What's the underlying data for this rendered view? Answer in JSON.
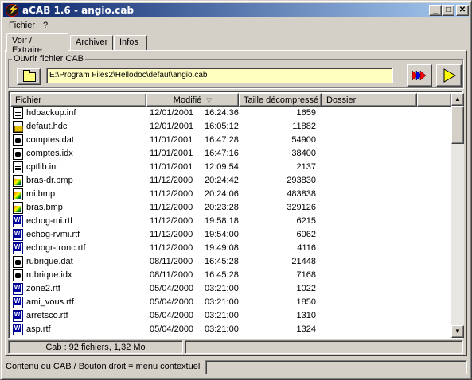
{
  "window": {
    "title": "aCAB 1.6 - angio.cab",
    "min_label": "_",
    "max_label": "□",
    "close_label": "✕"
  },
  "menu": {
    "fichier": "Fichier",
    "help": "?"
  },
  "tabs": [
    {
      "label": "Voir / Extraire",
      "active": true
    },
    {
      "label": "Archiver",
      "active": false
    },
    {
      "label": "Infos",
      "active": false
    }
  ],
  "open_group": {
    "legend": "Ouvrir fichier CAB",
    "path": "E:\\Program Files2\\Hellodoc\\defaut\\angio.cab"
  },
  "icons": {
    "open_button": "folder-open-icon",
    "extract_all_button": "extract-all-arrows-icon",
    "play_button": "play-icon"
  },
  "colors": {
    "title_gradient_start": "#0a246a",
    "title_gradient_end": "#a6caf0",
    "path_background": "#ffffc0",
    "arrow_red": "#ff0000",
    "arrow_blue": "#0000ff",
    "play_yellow": "#ffff00"
  },
  "list": {
    "columns": [
      "Fichier",
      "Modifié",
      "Taille décompressé",
      "Dossier"
    ],
    "rows": [
      {
        "name": "hdbackup.inf",
        "date": "12/01/2001",
        "time": "16:24:36",
        "size": "1659",
        "icon": "text-file-icon"
      },
      {
        "name": "defaut.hdc",
        "date": "12/01/2001",
        "time": "16:05:12",
        "size": "11882",
        "icon": "hdc-file-icon"
      },
      {
        "name": "comptes.dat",
        "date": "11/01/2001",
        "time": "16:47:28",
        "size": "54900",
        "icon": "dat-file-icon"
      },
      {
        "name": "comptes.idx",
        "date": "11/01/2001",
        "time": "16:47:16",
        "size": "38400",
        "icon": "dat-file-icon"
      },
      {
        "name": "cptlib.ini",
        "date": "11/01/2001",
        "time": "12:09:54",
        "size": "2137",
        "icon": "text-file-icon"
      },
      {
        "name": "bras-dr.bmp",
        "date": "11/12/2000",
        "time": "20:24:42",
        "size": "293830",
        "icon": "bitmap-file-icon"
      },
      {
        "name": "mi.bmp",
        "date": "11/12/2000",
        "time": "20:24:06",
        "size": "483838",
        "icon": "bitmap-file-icon"
      },
      {
        "name": "bras.bmp",
        "date": "11/12/2000",
        "time": "20:23:28",
        "size": "329126",
        "icon": "bitmap-file-icon"
      },
      {
        "name": "echog-mi.rtf",
        "date": "11/12/2000",
        "time": "19:58:18",
        "size": "6215",
        "icon": "word-document-icon"
      },
      {
        "name": "echog-rvmi.rtf",
        "date": "11/12/2000",
        "time": "19:54:00",
        "size": "6062",
        "icon": "word-document-icon"
      },
      {
        "name": "echogr-tronc.rtf",
        "date": "11/12/2000",
        "time": "19:49:08",
        "size": "4116",
        "icon": "word-document-icon"
      },
      {
        "name": "rubrique.dat",
        "date": "08/11/2000",
        "time": "16:45:28",
        "size": "21448",
        "icon": "dat-file-icon"
      },
      {
        "name": "rubrique.idx",
        "date": "08/11/2000",
        "time": "16:45:28",
        "size": "7168",
        "icon": "dat-file-icon"
      },
      {
        "name": "zone2.rtf",
        "date": "05/04/2000",
        "time": "03:21:00",
        "size": "1022",
        "icon": "word-document-icon"
      },
      {
        "name": "ami_vous.rtf",
        "date": "05/04/2000",
        "time": "03:21:00",
        "size": "1850",
        "icon": "word-document-icon"
      },
      {
        "name": "arretsco.rtf",
        "date": "05/04/2000",
        "time": "03:21:00",
        "size": "1310",
        "icon": "word-document-icon"
      },
      {
        "name": "asp.rtf",
        "date": "05/04/2000",
        "time": "03:21:00",
        "size": "1324",
        "icon": "word-document-icon"
      }
    ]
  },
  "inner_status": "Cab : 92 fichiers, 1,32 Mo",
  "status": "Contenu du CAB / Bouton droit = menu contextuel"
}
